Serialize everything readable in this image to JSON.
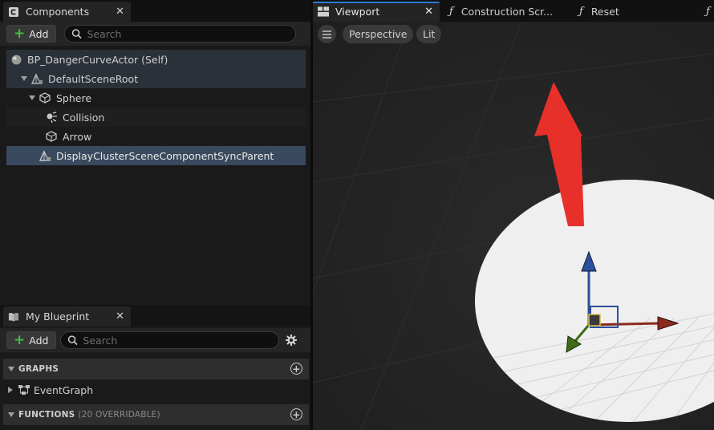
{
  "components_panel": {
    "tab_title": "Components",
    "add_label": "Add",
    "search_placeholder": "Search",
    "tree": [
      {
        "label": "BP_DangerCurveActor (Self)"
      },
      {
        "label": "DefaultSceneRoot"
      },
      {
        "label": "Sphere"
      },
      {
        "label": "Collision"
      },
      {
        "label": "Arrow"
      },
      {
        "label": "DisplayClusterSceneComponentSyncParent"
      }
    ]
  },
  "blueprint_panel": {
    "tab_title": "My Blueprint",
    "add_label": "Add",
    "search_placeholder": "Search",
    "sections": {
      "graphs": {
        "label": "GRAPHS"
      },
      "event_graph": {
        "label": "EventGraph"
      },
      "functions": {
        "label": "FUNCTIONS",
        "sub": "(20 OVERRIDABLE)"
      }
    }
  },
  "editor_tabs": [
    {
      "label": "Viewport"
    },
    {
      "label": "Construction Scr..."
    },
    {
      "label": "Reset"
    }
  ],
  "viewport": {
    "view_mode": "Perspective",
    "lighting_mode": "Lit"
  },
  "colors": {
    "accent_blue": "#2f7ad6",
    "add_green": "#46b946",
    "arrow_red": "#e8302a",
    "selection_row": "#3a4a5e"
  }
}
